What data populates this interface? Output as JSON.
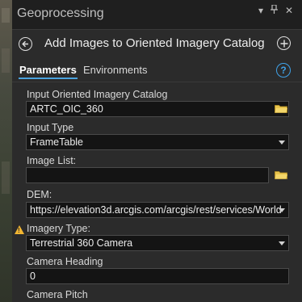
{
  "window": {
    "title": "Geoprocessing",
    "controls": [
      "▾",
      "⊞",
      "✕"
    ]
  },
  "tool": {
    "title": "Add Images to Oriented Imagery Catalog"
  },
  "tabs": {
    "parameters": "Parameters",
    "environments": "Environments",
    "help": "?"
  },
  "params": {
    "input_catalog": {
      "label": "Input Oriented Imagery Catalog",
      "value": "ARTC_OIC_360"
    },
    "input_type": {
      "label": "Input Type",
      "value": "FrameTable"
    },
    "image_list": {
      "label": "Image List:",
      "value": ""
    },
    "dem": {
      "label": "DEM:",
      "value": "https://elevation3d.arcgis.com/arcgis/rest/services/World"
    },
    "imagery_type": {
      "label": "Imagery Type:",
      "value": "Terrestrial 360 Camera"
    },
    "camera_heading": {
      "label": "Camera Heading",
      "value": "0"
    },
    "camera_pitch": {
      "label": "Camera Pitch"
    }
  },
  "colors": {
    "accent": "#4aa3df",
    "warning": "#f2b632",
    "folder": "#e8c44c"
  }
}
